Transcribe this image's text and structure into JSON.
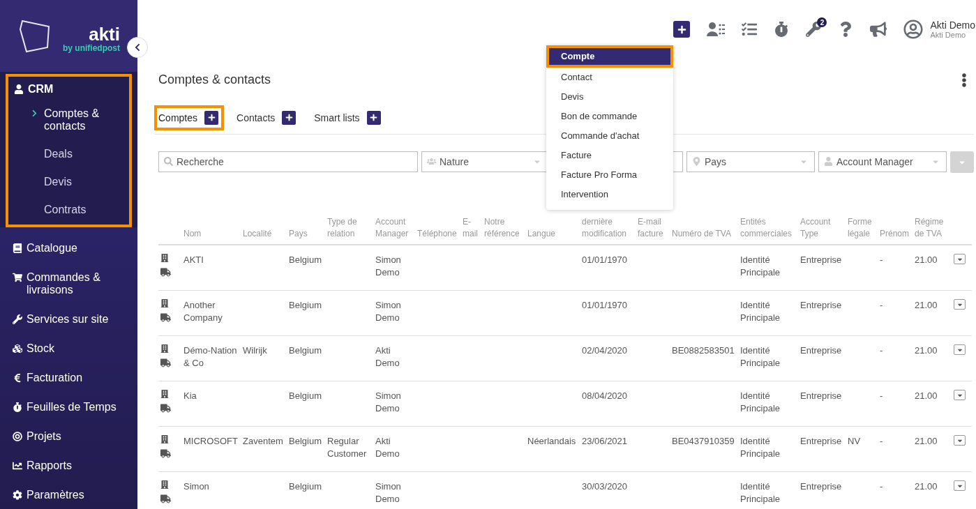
{
  "logo": {
    "name": "akti",
    "tagline": "by unifiedpost"
  },
  "sidebar": {
    "items": [
      {
        "label": "CRM",
        "expanded": true,
        "highlighted": true,
        "children": [
          {
            "label": "Comptes & contacts",
            "selected": true
          },
          {
            "label": "Deals",
            "selected": false
          },
          {
            "label": "Devis",
            "selected": false
          },
          {
            "label": "Contrats",
            "selected": false
          }
        ]
      },
      {
        "label": "Catalogue",
        "expanded": false
      },
      {
        "label": "Commandes & livraisons",
        "expanded": false
      },
      {
        "label": "Services sur site",
        "expanded": false
      },
      {
        "label": "Stock",
        "expanded": false
      },
      {
        "label": "Facturation",
        "expanded": false
      },
      {
        "label": "Feuilles de Temps",
        "expanded": false
      },
      {
        "label": "Projets",
        "expanded": false
      },
      {
        "label": "Rapports",
        "expanded": false
      },
      {
        "label": "Paramètres",
        "expanded": false
      }
    ]
  },
  "header": {
    "notification_badge": "2",
    "user": {
      "name": "Akti Demo",
      "company": "Akti Demo"
    }
  },
  "add_menu": {
    "items": [
      {
        "label": "Compte",
        "selected": true,
        "highlighted": true
      },
      {
        "label": "Contact",
        "selected": false,
        "highlighted": false
      },
      {
        "label": "Devis",
        "selected": false,
        "highlighted": false
      },
      {
        "label": "Bon de commande",
        "selected": false,
        "highlighted": false
      },
      {
        "label": "Commande d'achat",
        "selected": false,
        "highlighted": false
      },
      {
        "label": "Facture",
        "selected": false,
        "highlighted": false
      },
      {
        "label": "Facture Pro Forma",
        "selected": false,
        "highlighted": false
      },
      {
        "label": "Intervention",
        "selected": false,
        "highlighted": false
      }
    ]
  },
  "page_title": "Comptes & contacts",
  "tabs": [
    {
      "label": "Comptes",
      "selected": true,
      "highlighted": true
    },
    {
      "label": "Contacts",
      "selected": false,
      "highlighted": false
    },
    {
      "label": "Smart lists",
      "selected": false,
      "highlighted": false
    }
  ],
  "filters": [
    {
      "kind": "search",
      "placeholder": "Recherche"
    },
    {
      "kind": "select",
      "placeholder": "Nature"
    },
    {
      "kind": "hidden"
    },
    {
      "kind": "select",
      "placeholder": "Pays"
    },
    {
      "kind": "select",
      "placeholder": "Account Manager"
    }
  ],
  "table": {
    "columns": [
      "Nom",
      "Localité",
      "Pays",
      "Type de relation",
      "Account Manager",
      "Téléphone",
      "E-mail",
      "Notre référence",
      "Langue",
      "dernière modification",
      "E-mail facture",
      "Numéro de TVA",
      "Entités commerciales",
      "Account Type",
      "Forme légale",
      "Prénom",
      "Régime de TVA"
    ],
    "rows": [
      [
        "AKTI",
        "",
        "Belgium",
        "",
        "Simon Demo",
        "",
        "",
        "",
        "",
        "01/01/1970",
        "",
        "",
        "Identité Principale",
        "Entreprise",
        "",
        "-",
        "21.00"
      ],
      [
        "Another Company",
        "",
        "Belgium",
        "",
        "Simon Demo",
        "",
        "",
        "",
        "",
        "01/01/1970",
        "",
        "",
        "Identité Principale",
        "Entreprise",
        "",
        "-",
        "21.00"
      ],
      [
        "Démo-Nation & Co",
        "Wilrijk",
        "Belgium",
        "",
        "Akti Demo",
        "",
        "",
        "",
        "",
        "02/04/2020",
        "",
        "BE0882583501",
        "Identité Principale",
        "Entreprise",
        "",
        "-",
        "21.00"
      ],
      [
        "Kia",
        "",
        "Belgium",
        "",
        "Simon Demo",
        "",
        "",
        "",
        "",
        "08/04/2020",
        "",
        "",
        "Identité Principale",
        "Entreprise",
        "",
        "-",
        "21.00"
      ],
      [
        "MICROSOFT",
        "Zaventem",
        "Belgium",
        "Regular Customer",
        "Akti Demo",
        "",
        "",
        "",
        "Néerlandais",
        "23/06/2021",
        "",
        "BE0437910359",
        "Identité Principale",
        "Entreprise",
        "NV",
        "-",
        "21.00"
      ],
      [
        "Simon",
        "",
        "Belgium",
        "",
        "Simon Demo",
        "",
        "",
        "",
        "",
        "30/03/2020",
        "",
        "",
        "Identité Principale",
        "Entreprise",
        "",
        "-",
        "21.00"
      ]
    ]
  }
}
